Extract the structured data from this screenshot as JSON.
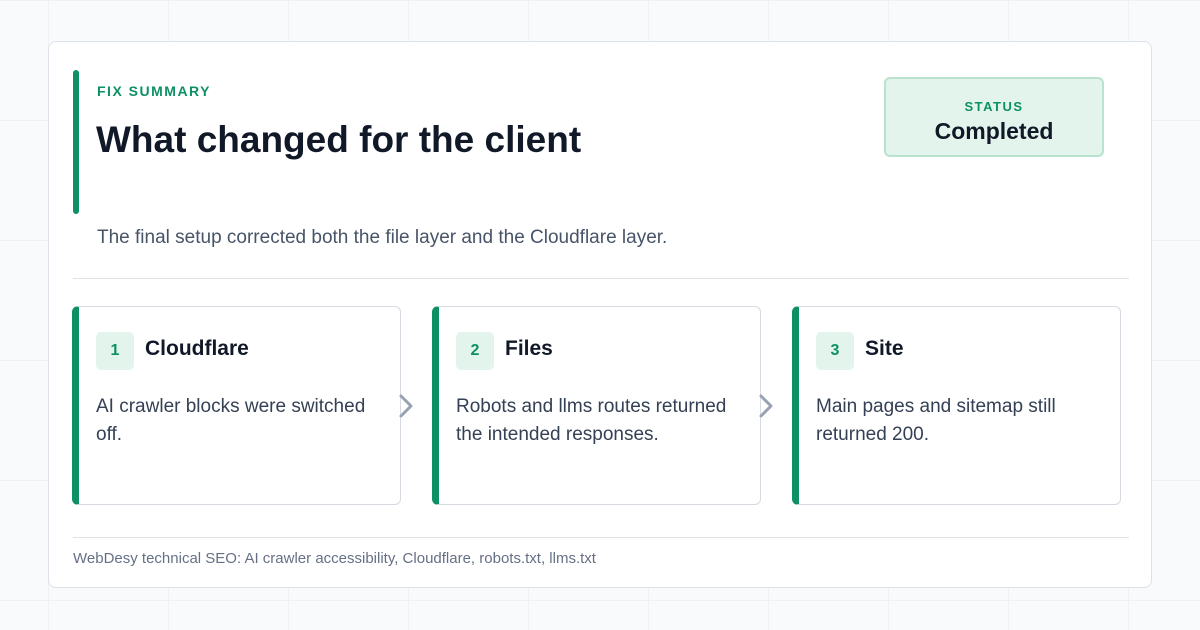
{
  "header": {
    "eyebrow": "FIX SUMMARY",
    "title": "What changed for the client",
    "subtitle": "The final setup corrected both the file layer and the Cloudflare layer."
  },
  "status": {
    "label": "STATUS",
    "value": "Completed"
  },
  "steps": [
    {
      "number": "1",
      "title": "Cloudflare",
      "description": "AI crawler blocks were switched off."
    },
    {
      "number": "2",
      "title": "Files",
      "description": "Robots and llms routes returned the intended responses."
    },
    {
      "number": "3",
      "title": "Site",
      "description": "Main pages and sitemap still returned 200."
    }
  ],
  "footer": {
    "text": "WebDesy technical SEO: AI crawler accessibility, Cloudflare, robots.txt, llms.txt"
  },
  "icons": {
    "step_connector": "chevron-right-icon"
  },
  "colors": {
    "accent": "#0d9164",
    "accent_light": "#e3f4ec",
    "heading": "#111827",
    "connector": "#98a2b3"
  }
}
